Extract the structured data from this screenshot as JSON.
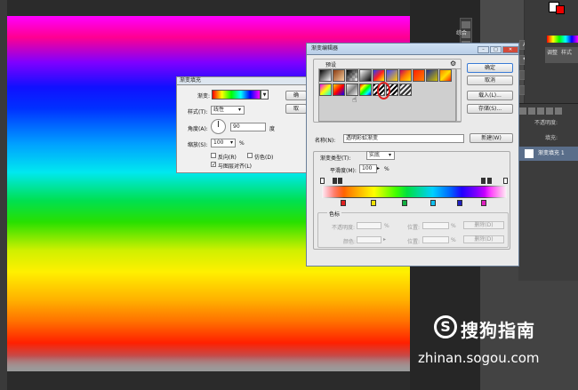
{
  "side_panel": {
    "mini_label": "综合",
    "adjust_tabs": [
      "调整",
      "样式"
    ],
    "icon_text": [
      "A",
      "¶"
    ],
    "opacity_label": "不透明度:",
    "fill_label": "填充:",
    "layer_name": "渐变填充 1"
  },
  "watermark": {
    "brand": "搜狗指南",
    "url": "zhinan.sogou.com",
    "logo_letter": "S"
  },
  "fill_dialog": {
    "title": "渐变填充",
    "gradient_label": "渐变:",
    "style_label": "样式(T):",
    "style_value": "线性",
    "angle_label": "角度(A):",
    "angle_value": "90",
    "angle_unit": "度",
    "scale_label": "缩放(S):",
    "scale_value": "100",
    "scale_unit": "%",
    "reverse_label": "反向(R)",
    "dither_label": "仿色(D)",
    "align_label": "与图层对齐(L)",
    "ok_partial": "确",
    "cancel_partial": "取"
  },
  "gradient_editor": {
    "title": "渐变编辑器",
    "presets_label": "预设",
    "ok": "确定",
    "cancel": "取消",
    "load": "载入(L)...",
    "save": "存储(S)...",
    "name_label": "名称(N):",
    "name_value": "透明彩虹渐变",
    "new_button": "新建(W)",
    "gradient_type_label": "渐变类型(T):",
    "gradient_type_value": "实底",
    "smoothness_label": "平滑度(M):",
    "smoothness_value": "100",
    "smoothness_unit": "%",
    "stops_label": "色标",
    "opacity_label": "不透明度:",
    "location_label": "位置:",
    "delete_label": "删除(D)",
    "color_label": "颜色:",
    "percent": "%"
  },
  "colors": {
    "red_stop": "#e02020",
    "yellow_stop": "#f0e000",
    "green_stop": "#10b040",
    "cyan_stop": "#10c0f0",
    "blue_stop": "#2020c0",
    "magenta_stop": "#e020c0"
  }
}
